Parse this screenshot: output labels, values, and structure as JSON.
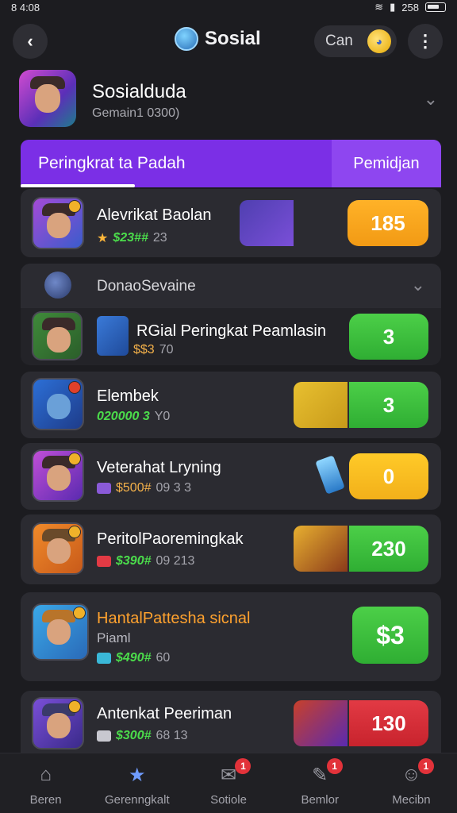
{
  "status_bar": {
    "time": "8 4:08",
    "right_text": "258"
  },
  "header": {
    "title": "Sosial",
    "currency_label": "Can",
    "coin_symbol": "◕"
  },
  "profile": {
    "name": "Sosialduda",
    "subtitle": "Gemain1 0300)"
  },
  "tabs": [
    {
      "label": "Peringkrat ta Padah",
      "active": true
    },
    {
      "label": "Pemidjan",
      "active": false
    }
  ],
  "section": {
    "title": "DonaoSevaine"
  },
  "rows": [
    {
      "name": "Alevrikat Baolan",
      "stat_value": "$23##",
      "stat_extra": "23",
      "score": "185",
      "score_color": "#f29a14"
    },
    {
      "name": "RGial Peringkat Peamlasin",
      "stat_value": "$$3",
      "stat_extra": "70",
      "score": "3",
      "score_color": "#2fae33"
    },
    {
      "name": "Elembek",
      "stat_value": "020000 3",
      "stat_extra": "Y0",
      "score": "3",
      "score_color": "#2fae33"
    },
    {
      "name": "Veterahat Lryning",
      "stat_value": "$500#",
      "stat_extra": "09  3 3",
      "score": "0",
      "score_color": "#f2b01a"
    },
    {
      "name": "PeritolPaoremingkak",
      "stat_value": "$390#",
      "stat_extra": "09 213",
      "score": "230",
      "score_color": "#2fae33"
    },
    {
      "name": "HantalPattesha sicnal",
      "sub_label": "Piaml",
      "stat_value": "$490#",
      "stat_extra": "60",
      "score": "$3",
      "score_color": "#2fae33"
    },
    {
      "name": "Antenkat Peeriman",
      "stat_value": "$300#",
      "stat_extra": "68  13",
      "score": "130",
      "score_color": "#c8232d"
    }
  ],
  "bottom_nav": [
    {
      "label": "Beren",
      "icon": "home-icon",
      "badge": ""
    },
    {
      "label": "Gerenngkalt",
      "icon": "rank-icon",
      "badge": ""
    },
    {
      "label": "Sotiole",
      "icon": "mail-icon",
      "badge": "1"
    },
    {
      "label": "Bemlor",
      "icon": "edit-icon",
      "badge": "1"
    },
    {
      "label": "Mecibn",
      "icon": "profile-icon",
      "badge": "1"
    }
  ]
}
